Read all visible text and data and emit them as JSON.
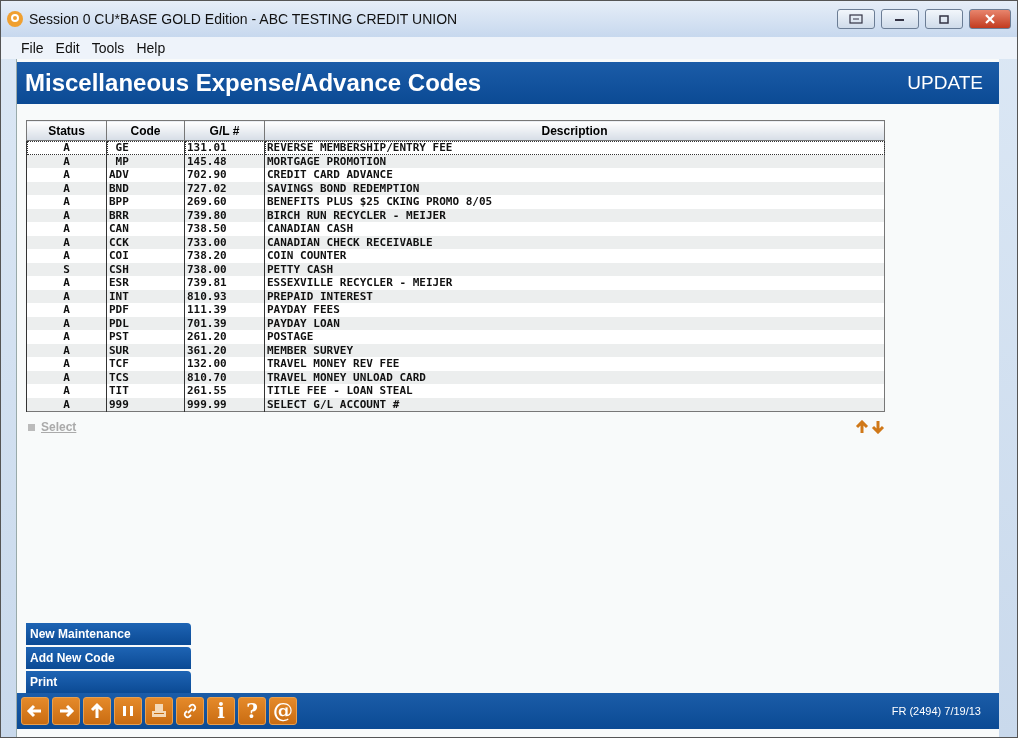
{
  "window": {
    "title": "Session 0 CU*BASE GOLD Edition - ABC TESTING CREDIT UNION"
  },
  "menu": [
    "File",
    "Edit",
    "Tools",
    "Help"
  ],
  "header": {
    "title": "Miscellaneous Expense/Advance Codes",
    "mode": "UPDATE"
  },
  "table": {
    "columns": [
      "Status",
      "Code",
      "G/L #",
      "Description"
    ],
    "rows": [
      {
        "cells": [
          "A",
          " GE",
          "131.01",
          "REVERSE MEMBERSHIP/ENTRY FEE"
        ],
        "selected": true
      },
      {
        "cells": [
          "A",
          " MP",
          "145.48",
          "MORTGAGE PROMOTION"
        ],
        "selected": false
      },
      {
        "cells": [
          "A",
          "ADV",
          "702.90",
          "CREDIT CARD ADVANCE"
        ],
        "selected": false
      },
      {
        "cells": [
          "A",
          "BND",
          "727.02",
          "SAVINGS BOND REDEMPTION"
        ],
        "selected": false
      },
      {
        "cells": [
          "A",
          "BPP",
          "269.60",
          "BENEFITS PLUS $25 CKING PROMO 8/05"
        ],
        "selected": false
      },
      {
        "cells": [
          "A",
          "BRR",
          "739.80",
          "BIRCH RUN RECYCLER - MEIJER"
        ],
        "selected": false
      },
      {
        "cells": [
          "A",
          "CAN",
          "738.50",
          "CANADIAN CASH"
        ],
        "selected": false
      },
      {
        "cells": [
          "A",
          "CCK",
          "733.00",
          "CANADIAN CHECK RECEIVABLE"
        ],
        "selected": false
      },
      {
        "cells": [
          "A",
          "COI",
          "738.20",
          "COIN COUNTER"
        ],
        "selected": false
      },
      {
        "cells": [
          "S",
          "CSH",
          "738.00",
          "PETTY CASH"
        ],
        "selected": false
      },
      {
        "cells": [
          "A",
          "ESR",
          "739.81",
          "ESSEXVILLE RECYCLER - MEIJER"
        ],
        "selected": false
      },
      {
        "cells": [
          "A",
          "INT",
          "810.93",
          "PREPAID INTEREST"
        ],
        "selected": false
      },
      {
        "cells": [
          "A",
          "PDF",
          "111.39",
          "PAYDAY FEES"
        ],
        "selected": false
      },
      {
        "cells": [
          "A",
          "PDL",
          "701.39",
          "PAYDAY LOAN"
        ],
        "selected": false
      },
      {
        "cells": [
          "A",
          "PST",
          "261.20",
          "POSTAGE"
        ],
        "selected": false
      },
      {
        "cells": [
          "A",
          "SUR",
          "361.20",
          "MEMBER SURVEY"
        ],
        "selected": false
      },
      {
        "cells": [
          "A",
          "TCF",
          "132.00",
          "TRAVEL MONEY REV FEE"
        ],
        "selected": false
      },
      {
        "cells": [
          "A",
          "TCS",
          "810.70",
          "TRAVEL MONEY UNLOAD CARD"
        ],
        "selected": false
      },
      {
        "cells": [
          "A",
          "TIT",
          "261.55",
          "TITLE FEE - LOAN STEAL"
        ],
        "selected": false
      },
      {
        "cells": [
          "A",
          "999",
          "999.99",
          "SELECT G/L ACCOUNT #"
        ],
        "selected": false
      }
    ]
  },
  "select_action": {
    "label": "Select",
    "disabled": true
  },
  "actions": [
    "New Maintenance",
    "Add New Code",
    "Print"
  ],
  "toolbar": [
    {
      "kind": "back"
    },
    {
      "kind": "forward"
    },
    {
      "kind": "up"
    },
    {
      "kind": "pause"
    },
    {
      "kind": "printer"
    },
    {
      "kind": "link"
    },
    {
      "kind": "glyph",
      "label": "i"
    },
    {
      "kind": "glyph",
      "label": "?"
    },
    {
      "kind": "glyph",
      "label": "@"
    }
  ],
  "status": "FR (2494) 7/19/13"
}
